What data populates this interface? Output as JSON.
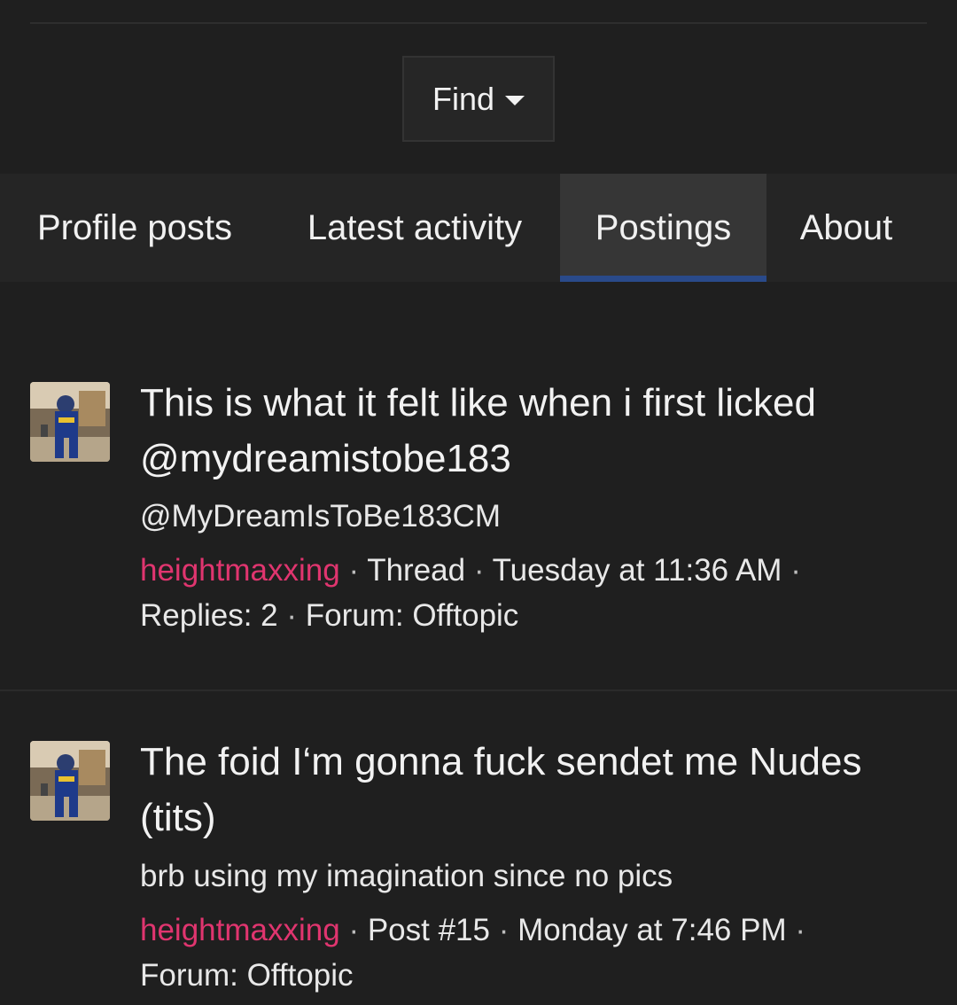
{
  "find": {
    "label": "Find"
  },
  "tabs": [
    {
      "label": "Profile posts",
      "active": false
    },
    {
      "label": "Latest activity",
      "active": false
    },
    {
      "label": "Postings",
      "active": true
    },
    {
      "label": "About",
      "active": false
    }
  ],
  "posts": [
    {
      "title_line1": "This is what it felt like when i first licked",
      "title_line2": "@mydreamistobe183",
      "snippet": "@MyDreamIsToBe183CM",
      "author": "heightmaxxing",
      "type": "Thread",
      "date": "Tuesday at 11:36 AM",
      "extra": "Replies: 2",
      "forum": "Forum: Offtopic"
    },
    {
      "title_line1": "The foid I‘m gonna fuck sendet me Nudes",
      "title_line2": "(tits)",
      "snippet": "brb using my imagination since no pics",
      "author": "heightmaxxing",
      "type": "Post #15",
      "date": "Monday at 7:46 PM",
      "forum": "Forum: Offtopic"
    }
  ],
  "colors": {
    "background": "#1f1f1f",
    "tabbar": "#252525",
    "active_tab": "#363636",
    "active_underline": "#2a4a8a",
    "author_link": "#e0356f"
  },
  "icons": {
    "find_caret": "caret-down-icon",
    "avatar": "user-avatar"
  }
}
